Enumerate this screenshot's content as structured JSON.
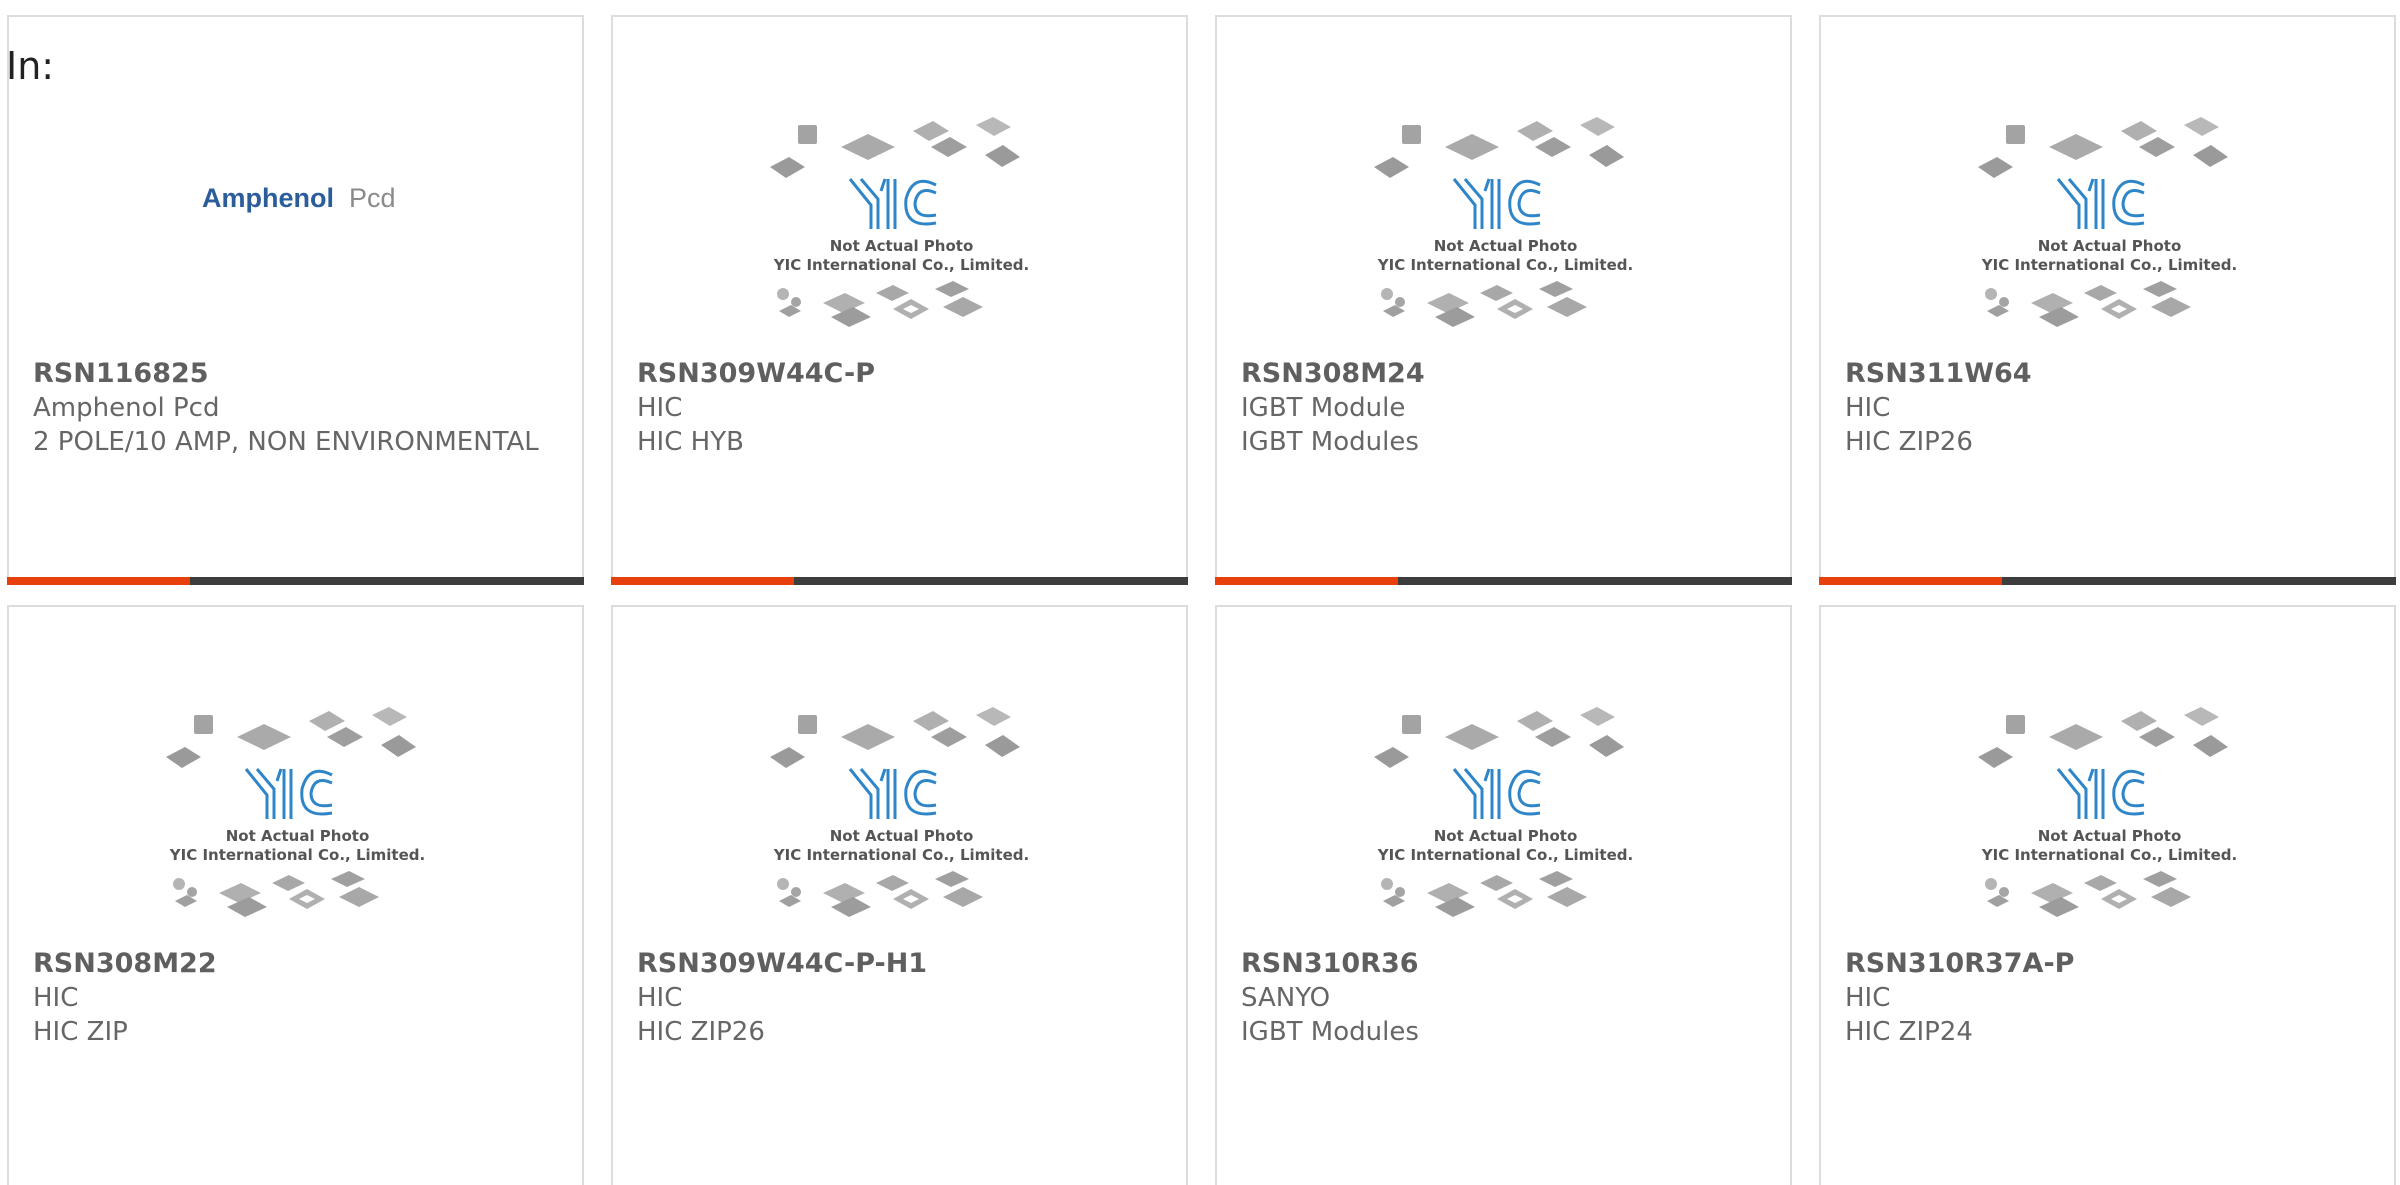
{
  "heading": "In:",
  "colors": {
    "accent": "#e8400c",
    "bar": "#3d3d3d",
    "yic_blue": "#2e86c8"
  },
  "amphenol_logo": {
    "brand": "Amphenol",
    "suffix": "Pcd"
  },
  "placeholder_image": {
    "line1": "Not Actual Photo",
    "line2": "YIC International Co., Limited."
  },
  "products": [
    {
      "part_number": "RSN116825",
      "manufacturer": "Amphenol Pcd",
      "description": "2 POLE/10 AMP, NON ENVIRONMENTAL",
      "image": "amphenol-logo"
    },
    {
      "part_number": "RSN309W44C-P",
      "manufacturer": "HIC",
      "description": "HIC HYB",
      "image": "yic-placeholder"
    },
    {
      "part_number": "RSN308M24",
      "manufacturer": "IGBT Module",
      "description": "IGBT Modules",
      "image": "yic-placeholder"
    },
    {
      "part_number": "RSN311W64",
      "manufacturer": "HIC",
      "description": "HIC ZIP26",
      "image": "yic-placeholder"
    },
    {
      "part_number": "RSN308M22",
      "manufacturer": "HIC",
      "description": "HIC ZIP",
      "image": "yic-placeholder"
    },
    {
      "part_number": "RSN309W44C-P-H1",
      "manufacturer": "HIC",
      "description": "HIC ZIP26",
      "image": "yic-placeholder"
    },
    {
      "part_number": "RSN310R36",
      "manufacturer": "SANYO",
      "description": "IGBT Modules",
      "image": "yic-placeholder"
    },
    {
      "part_number": "RSN310R37A-P",
      "manufacturer": "HIC",
      "description": "HIC ZIP24",
      "image": "yic-placeholder"
    }
  ]
}
